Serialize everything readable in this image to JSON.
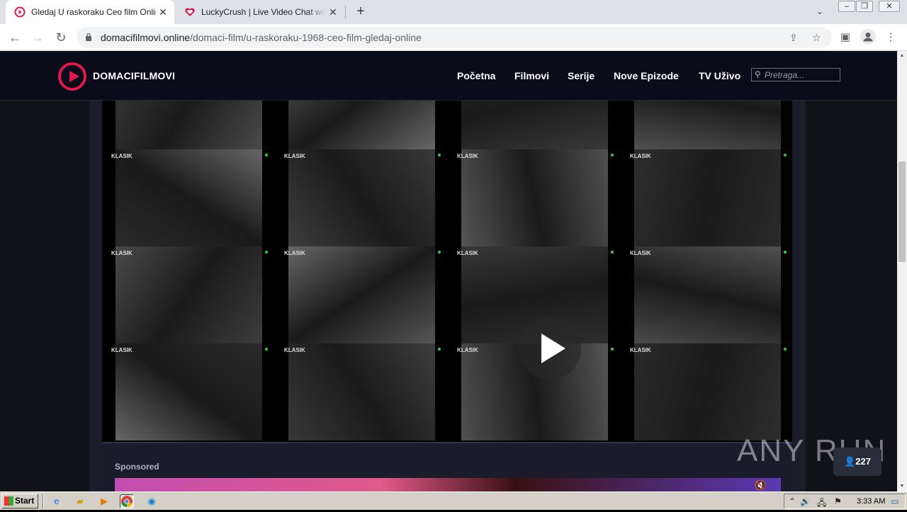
{
  "browser": {
    "tabs": [
      {
        "title": "Gledaj U raskoraku Ceo film Online",
        "active": true,
        "favicon_color": "#e0194d"
      },
      {
        "title": "LuckyCrush | Live Video Chat with Ra",
        "active": false,
        "favicon_color": "#e0194d"
      }
    ],
    "url_host": "domacifilmovi.online",
    "url_path": "/domaci-film/u-raskoraku-1968-ceo-film-gledaj-online"
  },
  "site": {
    "logo_text": "DOMACIFILMOVI",
    "nav": [
      "Početna",
      "Filmovi",
      "Serije",
      "Nove Epizode",
      "TV Uživo"
    ],
    "search_placeholder": "Pretraga...",
    "accent_color": "#e0194d"
  },
  "player": {
    "thumbnail_label": "KLASIK",
    "rows": 4,
    "cols": 4
  },
  "sponsored": {
    "heading": "Sponsored"
  },
  "overlay": {
    "watermark": "ANY RUN",
    "users_count": "227"
  },
  "taskbar": {
    "start_label": "Start",
    "clock": "3:33 AM"
  }
}
